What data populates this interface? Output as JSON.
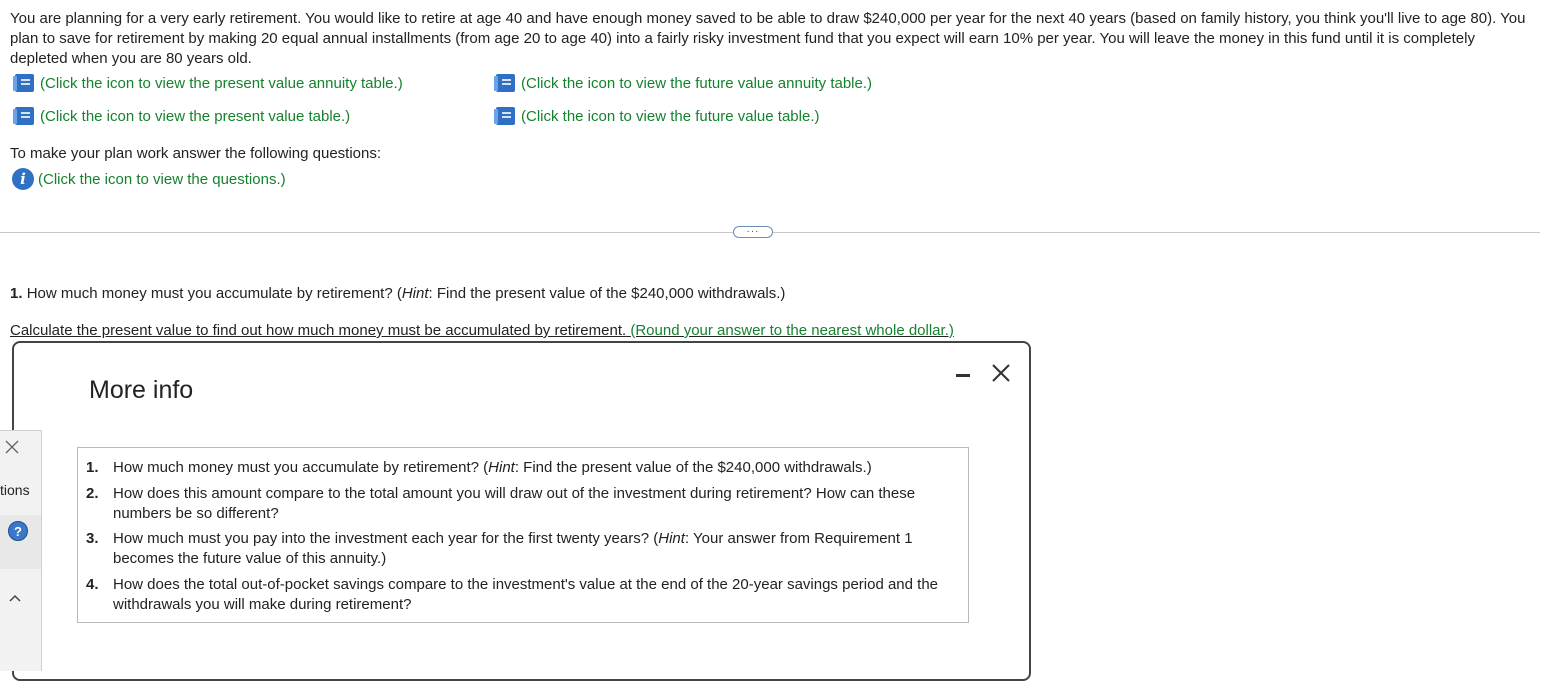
{
  "problem": {
    "text": "You are planning for a very early retirement. You would like to retire at age 40 and have enough money saved to be able to draw $240,000 per year for the next 40 years (based on family history, you think you'll live to age 80). You plan to save for retirement by making 20 equal annual installments (from age 20 to age 40) into a fairly risky investment fund that you expect will earn 10% per year. You will leave the money in this fund until it is completely depleted when you are 80 years old."
  },
  "links": {
    "pv_annuity": "(Click the icon to view the present value annuity table.)",
    "fv_annuity": "(Click the icon to view the future value annuity table.)",
    "pv_table": "(Click the icon to view the present value table.)",
    "fv_table": "(Click the icon to view the future value table.)",
    "questions": "(Click the icon to view the questions.)"
  },
  "instructions": "To make your plan work answer the following questions:",
  "expand_handle": "···",
  "question1": {
    "number": "1.",
    "text_before": "How much money must you accumulate by retirement? (",
    "hint": "Hint",
    "text_after": ": Find the present value of the $240,000 withdrawals.)"
  },
  "calc": {
    "text": "Calculate the present value to find out how much money must be accumulated by retirement.",
    "round": "(Round your answer to the nearest whole dollar.)"
  },
  "modal": {
    "title": "More info",
    "questions": [
      {
        "num": "1.",
        "a": "How much money must you accumulate by retirement? (",
        "hint": "Hint",
        "b": ": Find the present value of the $240,000 withdrawals.)"
      },
      {
        "num": "2.",
        "a": "How does this amount compare to the total amount you will draw out of the investment during retirement? How can these numbers be so different?",
        "hint": "",
        "b": ""
      },
      {
        "num": "3.",
        "a": "How much must you pay into the investment each year for the first twenty years? (",
        "hint": "Hint",
        "b": ": Your answer from Requirement 1 becomes the future value of this annuity.)"
      },
      {
        "num": "4.",
        "a": "How does the total out-of-pocket savings compare to the investment's value at the end of the 20-year savings period and the withdrawals you will make during retirement?",
        "hint": "",
        "b": ""
      }
    ]
  },
  "side": {
    "label": "tions",
    "help": "?"
  },
  "colors": {
    "link": "#15822d",
    "icon_blue": "#2e72c5"
  },
  "icons": {
    "table": "book-icon",
    "info": "info-icon",
    "close": "close-icon",
    "minimize": "minimize-icon",
    "help": "help-icon",
    "chevron": "chevron-up-icon"
  }
}
